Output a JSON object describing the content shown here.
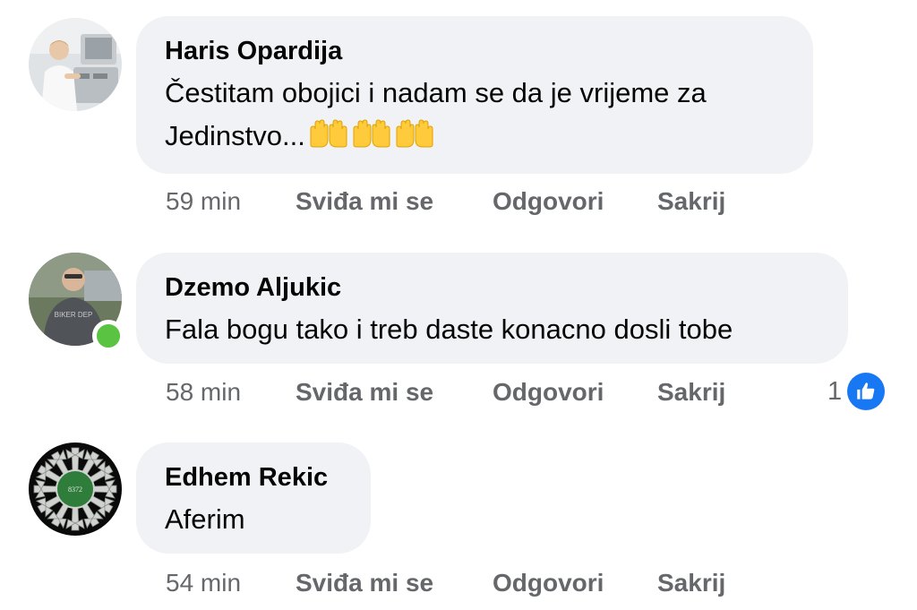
{
  "comments": [
    {
      "author": "Haris Opardija",
      "text": "Čestitam obojici i nadam se da je vrijeme za",
      "text2": "Jedinstvo...",
      "emoji": [
        "raising-hands-emoji",
        "raising-hands-emoji",
        "raising-hands-emoji"
      ],
      "time": "59 min",
      "like_label": "Sviđa mi se",
      "reply_label": "Odgovori",
      "hide_label": "Sakrij"
    },
    {
      "author": "Dzemo Aljukic",
      "text": "Fala bogu tako i treb daste konacno dosli tobe",
      "time": "58 min",
      "like_label": "Sviđa mi se",
      "reply_label": "Odgovori",
      "hide_label": "Sakrij",
      "reaction_count": "1",
      "reaction_icon": "like-thumb-icon",
      "online": true
    },
    {
      "author": "Edhem Rekic",
      "text": "Aferim",
      "avatar_text": "8372",
      "time": "54 min",
      "like_label": "Sviđa mi se",
      "reply_label": "Odgovori",
      "hide_label": "Sakrij"
    }
  ],
  "colors": {
    "bubble": "#f0f2f5",
    "meta_text": "#65676b",
    "like_blue": "#1877f2",
    "online_green": "#5ac341"
  }
}
